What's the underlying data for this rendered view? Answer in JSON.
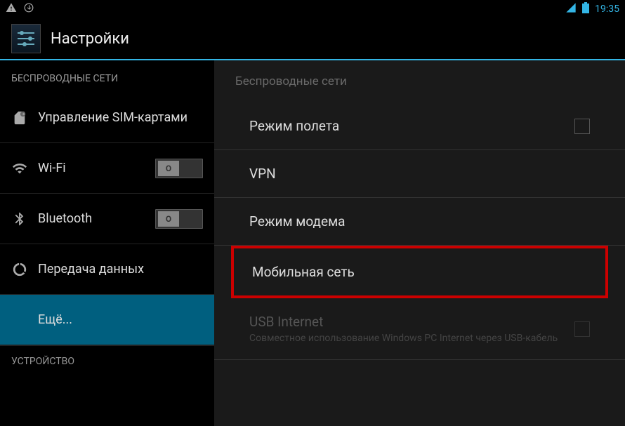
{
  "status": {
    "time": "19:35"
  },
  "header": {
    "title": "Настройки"
  },
  "sidebar": {
    "section_wireless": "БЕСПРОВОДНЫЕ СЕТИ",
    "section_device": "УСТРОЙСТВО",
    "items": {
      "sim": "Управление SIM-картами",
      "wifi": "Wi-Fi",
      "bluetooth": "Bluetooth",
      "data": "Передача данных",
      "more": "Ещё..."
    },
    "toggle_off": "O"
  },
  "main": {
    "header": "Беспроводные сети",
    "airplane": "Режим полета",
    "vpn": "VPN",
    "tether": "Режим модема",
    "mobile": "Мобильная сеть",
    "usb_title": "USB Internet",
    "usb_sub": "Совместное использование Windows PC Internet через USB-кабель"
  }
}
